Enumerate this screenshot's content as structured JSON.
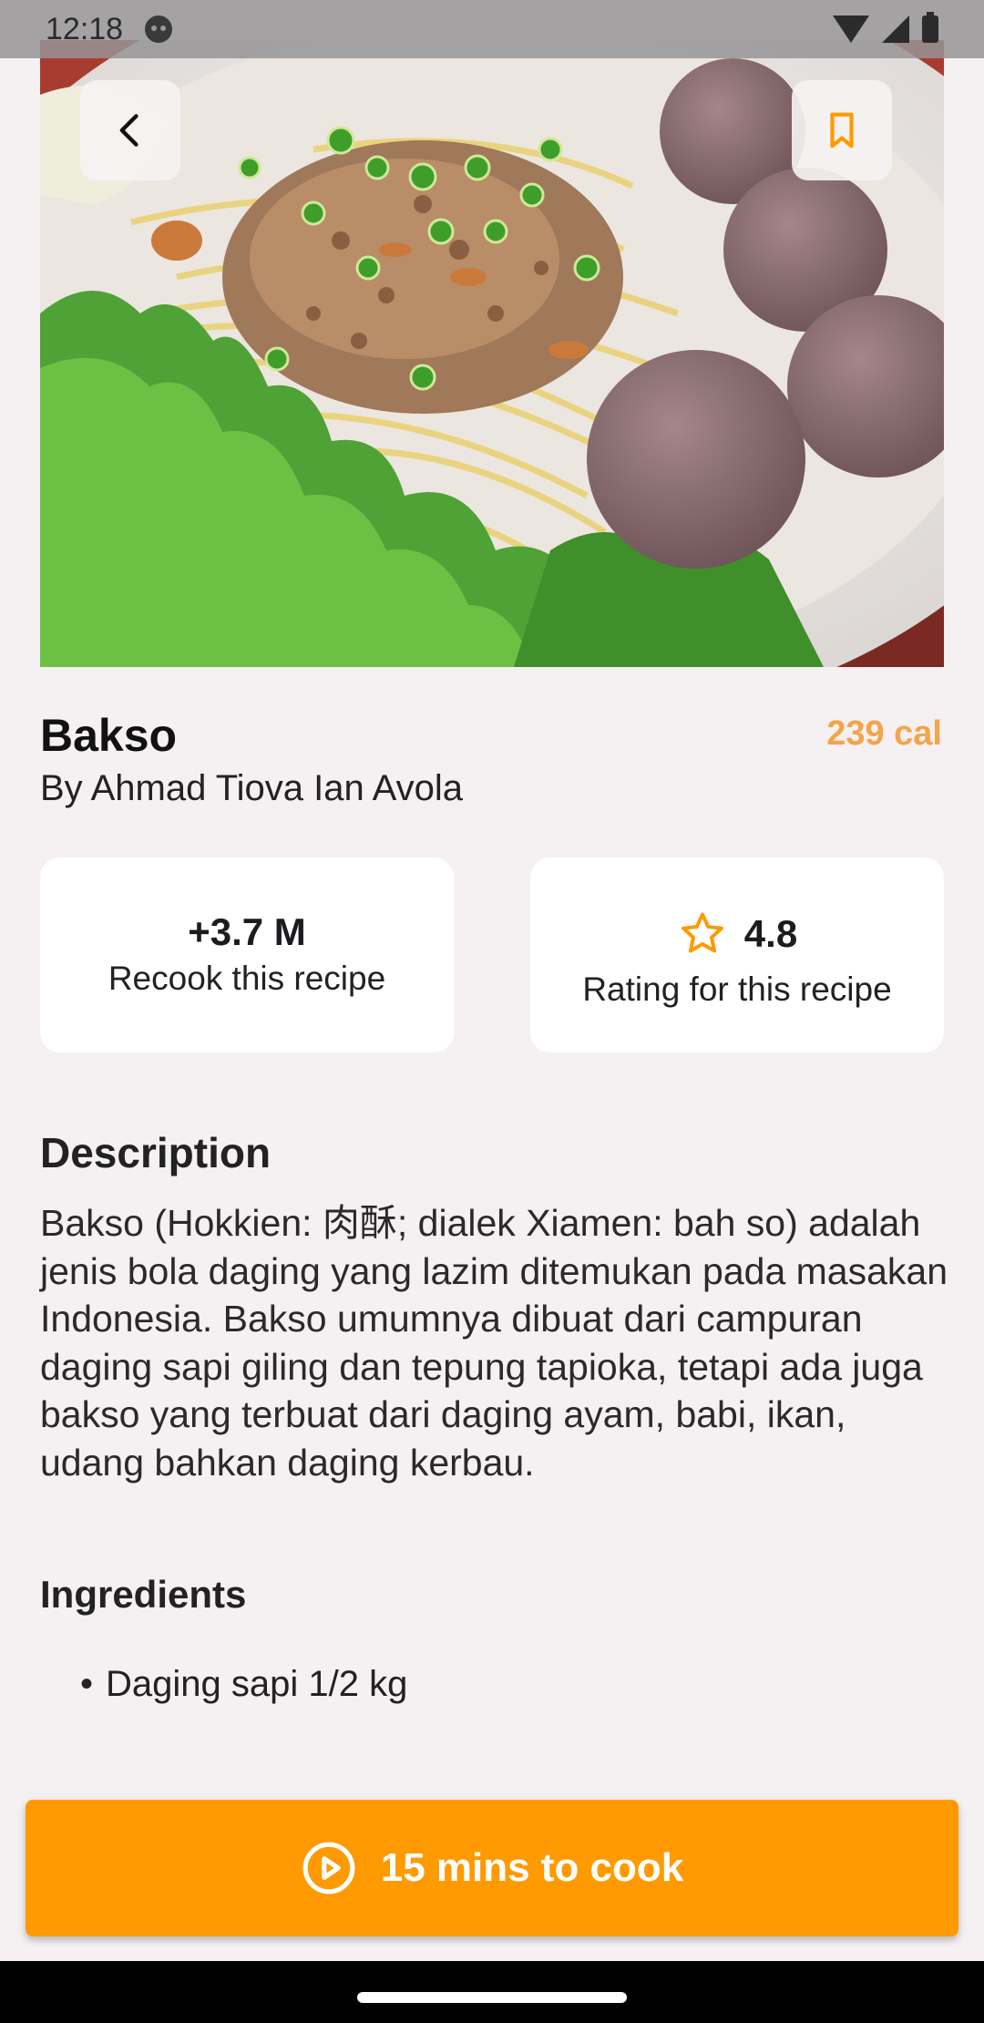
{
  "status_bar": {
    "time": "12:18"
  },
  "recipe": {
    "title": "Bakso",
    "calories": "239 cal",
    "author": "By Ahmad Tiova Ian Avola"
  },
  "stats": {
    "recook_value": "+3.7 M",
    "recook_label": "Recook this recipe",
    "rating_value": "4.8",
    "rating_label": "Rating for this recipe"
  },
  "description": {
    "heading": "Description",
    "text": "Bakso (Hokkien: 肉酥; dialek Xiamen: bah so) adalah jenis bola daging yang lazim ditemukan pada masakan Indonesia. Bakso umumnya dibuat dari campuran daging sapi giling dan tepung tapioka, tetapi ada juga bakso yang terbuat dari daging ayam, babi, ikan, udang bahkan daging kerbau."
  },
  "ingredients": {
    "heading": "Ingredients",
    "items": [
      "Daging sapi 1/2 kg"
    ]
  },
  "cook_button": {
    "label": "15 mins to cook"
  },
  "icons": {
    "back": "arrow-back-icon",
    "bookmark": "bookmark-icon",
    "star": "star-outline-icon",
    "play": "play-circle-icon"
  },
  "colors": {
    "accent": "#ff9a03",
    "calories": "#f4a44a",
    "background": "#f5f0f1"
  }
}
